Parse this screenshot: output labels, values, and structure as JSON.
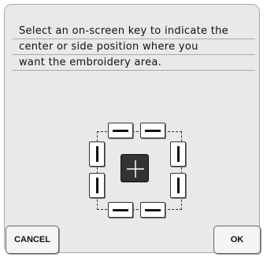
{
  "instructions": {
    "lines": [
      "Select an on-screen key to indicate the",
      "center or side position where you",
      "want the embroidery area."
    ]
  },
  "position_keys": [
    {
      "id": "top-left",
      "orientation": "horizontal",
      "icon": "horizontal-bar-icon"
    },
    {
      "id": "top-right",
      "orientation": "horizontal",
      "icon": "horizontal-bar-icon"
    },
    {
      "id": "left-upper",
      "orientation": "vertical",
      "icon": "vertical-bar-icon"
    },
    {
      "id": "left-lower",
      "orientation": "vertical",
      "icon": "vertical-bar-icon"
    },
    {
      "id": "center",
      "icon": "crosshair-icon"
    },
    {
      "id": "right-upper",
      "orientation": "vertical",
      "icon": "vertical-bar-icon"
    },
    {
      "id": "right-lower",
      "orientation": "vertical",
      "icon": "vertical-bar-icon"
    },
    {
      "id": "bottom-left",
      "orientation": "horizontal",
      "icon": "horizontal-bar-icon"
    },
    {
      "id": "bottom-right",
      "orientation": "horizontal",
      "icon": "horizontal-bar-icon"
    }
  ],
  "buttons": {
    "cancel_label": "CANCEL",
    "ok_label": "OK"
  },
  "colors": {
    "panel_background": "#e9e9e9",
    "center_key": "#333333"
  }
}
